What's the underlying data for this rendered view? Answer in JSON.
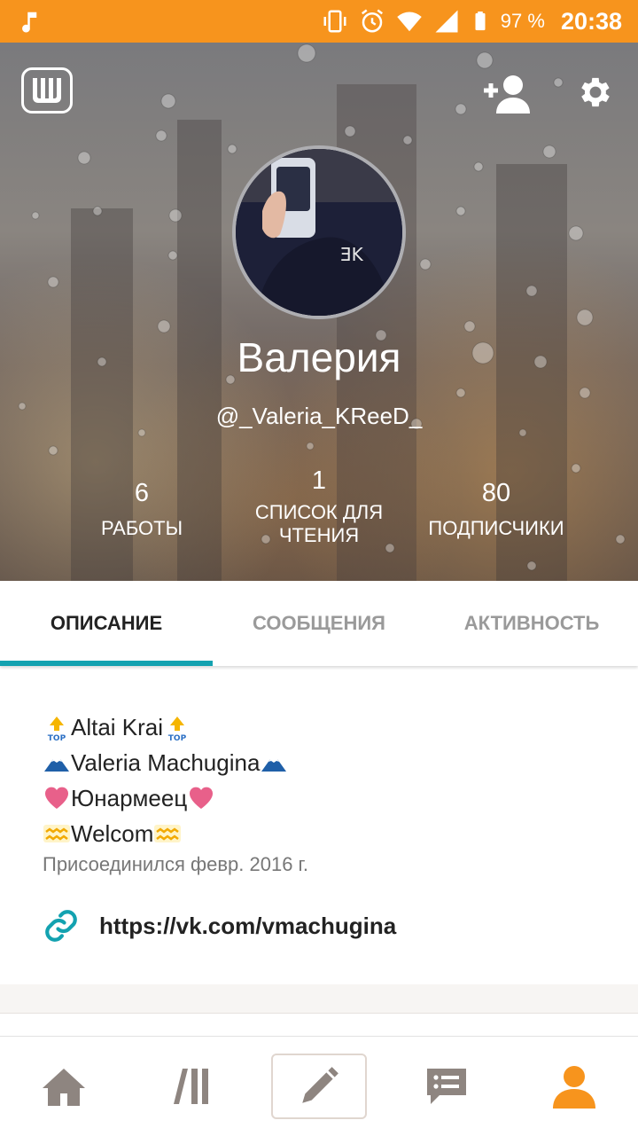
{
  "status_bar": {
    "battery_percent": "97 %",
    "time": "20:38",
    "color": "#f7941d",
    "icons": [
      "music-note-icon",
      "vibrate-icon",
      "alarm-icon",
      "wifi-icon",
      "signal-icon",
      "battery-icon"
    ]
  },
  "header": {
    "logo_icon": "wattpad-logo-icon",
    "add_friend_icon": "add-friend-icon",
    "settings_icon": "gear-icon"
  },
  "profile": {
    "name": "Валерия",
    "username": "@_Valeria_KReeD_",
    "stats": {
      "works": {
        "value": "6",
        "label": "РАБОТЫ"
      },
      "reading_lists": {
        "value": "1",
        "label_line1": "СПИСОК ДЛЯ",
        "label_line2": "ЧТЕНИЯ"
      },
      "followers": {
        "value": "80",
        "label": "ПОДПИСЧИКИ"
      }
    }
  },
  "tabs": [
    {
      "label": "ОПИСАНИЕ",
      "active": true
    },
    {
      "label": "СООБЩЕНИЯ",
      "active": false
    },
    {
      "label": "АКТИВНОСТЬ",
      "active": false
    }
  ],
  "accent_color": "#13a2b0",
  "description": {
    "lines": [
      {
        "text": "Altai Krai",
        "emoji": "top-arrow-icon"
      },
      {
        "text": "Valeria Machugina",
        "emoji": "mount-fuji-icon"
      },
      {
        "text": "Юнармеец",
        "emoji": "heart-icon"
      },
      {
        "text": "Welcom",
        "emoji": "aquarius-icon"
      }
    ],
    "joined": "Присоединился февр. 2016 г.",
    "link": "https://vk.com/vmachugina"
  },
  "bottom_nav": {
    "items": [
      "home-icon",
      "library-icon",
      "write-icon",
      "messages-icon",
      "profile-icon"
    ],
    "active": "profile-icon",
    "active_color": "#f7941d",
    "inactive_color": "#8e8580"
  }
}
